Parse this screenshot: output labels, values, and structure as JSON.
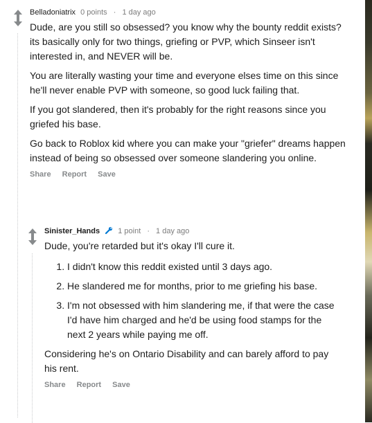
{
  "comments": [
    {
      "author": "Belladoniatrix",
      "points": "0 points",
      "time": "1 day ago",
      "paragraphs": [
        "Dude, are you still so obsessed? you know why the bounty reddit exists? its basically only for two things, griefing or PVP, which Sinseer isn't interested in, and NEVER will be.",
        "You are literally wasting your time and everyone elses time on this since he'll never enable PVP with someone, so good luck failing that.",
        "If you got slandered, then it's probably for the right reasons since you griefed his base.",
        "Go back to Roblox kid where you can make your \"griefer\" dreams happen instead of being so obsessed over someone slandering you online."
      ],
      "actions": [
        "Share",
        "Report",
        "Save"
      ]
    },
    {
      "author": "Sinister_Hands",
      "points": "1 point",
      "time": "1 day ago",
      "intro": "Dude, you're retarded but it's okay I'll cure it.",
      "list": [
        "I didn't know this reddit existed until 3 days ago.",
        "He slandered me for months, prior to me griefing his base.",
        "I'm not obsessed with him slandering me, if that were the case I'd have him charged and he'd be using food stamps for the next 2 years while paying me off."
      ],
      "outro": "Considering he's on Ontario Disability and can barely afford to pay his rent.",
      "actions": [
        "Share",
        "Report",
        "Save"
      ]
    }
  ],
  "colors": {
    "accent": "#0079d3",
    "meta": "#7c7c7c",
    "arrow": "#878a8c"
  },
  "icons": {
    "upvote": "arrow-up-icon",
    "downvote": "arrow-down-icon",
    "mod": "wrench-icon"
  }
}
